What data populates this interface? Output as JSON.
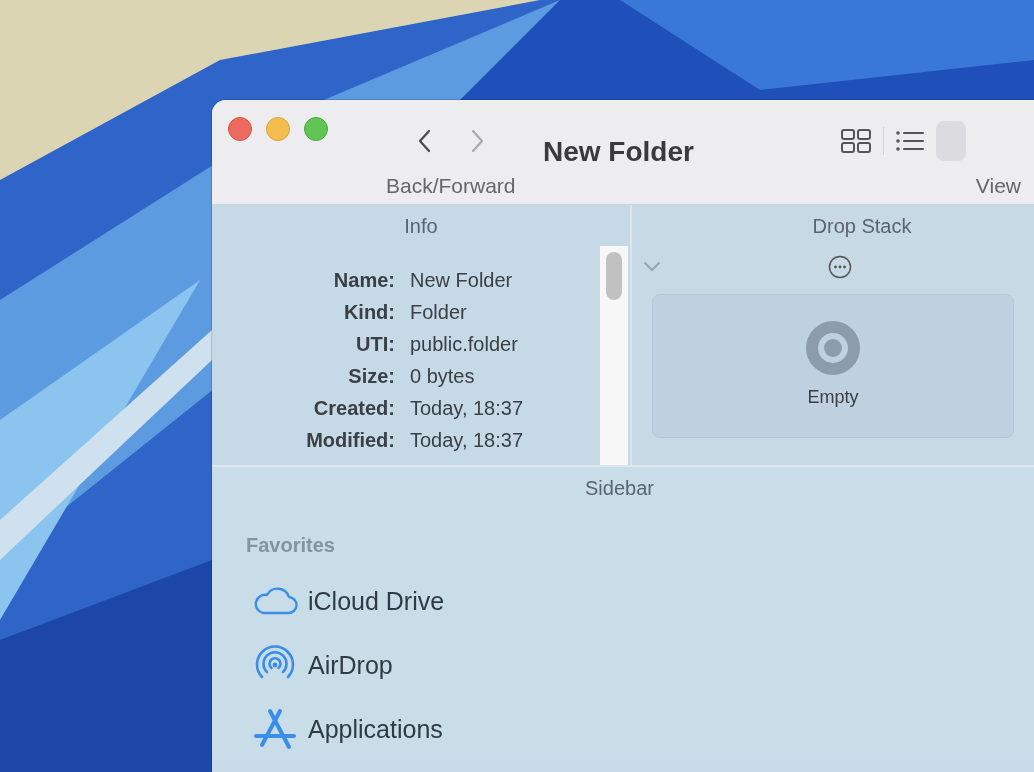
{
  "window": {
    "title": "New Folder"
  },
  "toolbar": {
    "nav_buttons": [
      {
        "kind": "back",
        "disabled": false
      },
      {
        "kind": "forward",
        "disabled": true
      }
    ],
    "nav_label": "Back/Forward",
    "view_label": "View"
  },
  "info": {
    "title": "Info",
    "fields": [
      {
        "label": "Name:",
        "value": "New Folder"
      },
      {
        "label": "Kind:",
        "value": "Folder"
      },
      {
        "label": "UTI:",
        "value": "public.folder"
      },
      {
        "label": "Size:",
        "value": "0 bytes"
      },
      {
        "label": "Created:",
        "value": "Today, 18:37"
      },
      {
        "label": "Modified:",
        "value": "Today, 18:37"
      }
    ]
  },
  "drop_stack": {
    "title": "Drop Stack",
    "status": "Empty"
  },
  "sidebar": {
    "title": "Sidebar",
    "section": "Favorites",
    "items": [
      {
        "label": "iCloud Drive",
        "kind": "cloud"
      },
      {
        "label": "AirDrop",
        "kind": "airdrop"
      },
      {
        "label": "Applications",
        "kind": "apps"
      }
    ]
  }
}
